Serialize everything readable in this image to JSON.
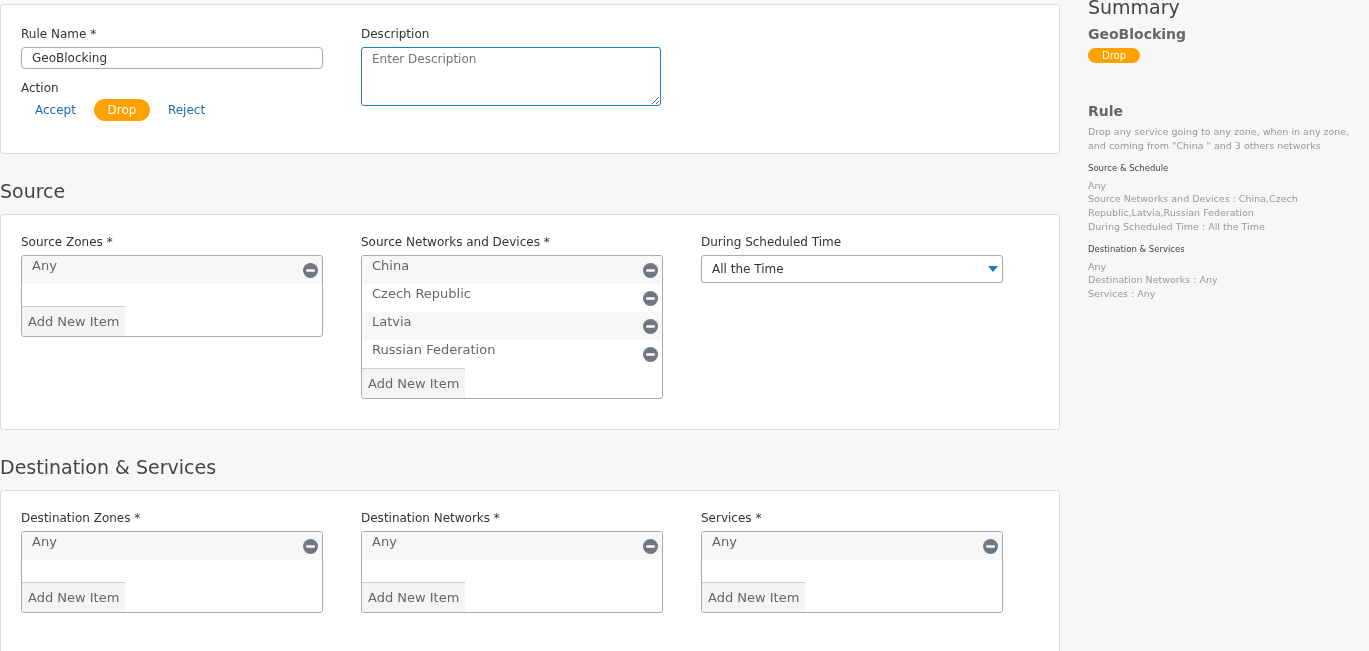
{
  "rule_form": {
    "name_label": "Rule Name *",
    "name_value": "GeoBlocking",
    "action_label": "Action",
    "actions": [
      {
        "label": "Accept",
        "selected": false
      },
      {
        "label": "Drop",
        "selected": true
      },
      {
        "label": "Reject",
        "selected": false
      }
    ],
    "description_label": "Description",
    "description_placeholder": "Enter Description"
  },
  "sections": [
    {
      "title": "Source",
      "fields": [
        {
          "kind": "list",
          "label": "Source Zones *",
          "items": [
            "Any"
          ],
          "add_label": "Add New Item"
        },
        {
          "kind": "list",
          "label": "Source Networks and Devices *",
          "items": [
            "China",
            "Czech Republic",
            "Latvia",
            "Russian Federation"
          ],
          "add_label": "Add New Item"
        },
        {
          "kind": "select",
          "label": "During Scheduled Time",
          "value": "All the Time"
        }
      ]
    },
    {
      "title": "Destination & Services",
      "fields": [
        {
          "kind": "list",
          "label": "Destination Zones *",
          "items": [
            "Any"
          ],
          "add_label": "Add New Item"
        },
        {
          "kind": "list",
          "label": "Destination Networks *",
          "items": [
            "Any"
          ],
          "add_label": "Add New Item"
        },
        {
          "kind": "list",
          "label": "Services *",
          "items": [
            "Any"
          ],
          "add_label": "Add New Item"
        }
      ]
    }
  ],
  "summary": {
    "title": "Summary",
    "rule_name": "GeoBlocking",
    "action_badge": "Drop",
    "rule_heading": "Rule",
    "rule_text": "Drop any service going to any zone, when in any zone, and coming from \"China \" and 3 others networks",
    "groups": [
      {
        "heading": "Source & Schedule",
        "lines": [
          "Any",
          "Source Networks and Devices : China,Czech Republic,Latvia,Russian Federation",
          "During Scheduled Time : All the Time"
        ]
      },
      {
        "heading": "Destination & Services",
        "lines": [
          "Any",
          "Destination Networks : Any",
          "Services : Any"
        ]
      }
    ]
  }
}
